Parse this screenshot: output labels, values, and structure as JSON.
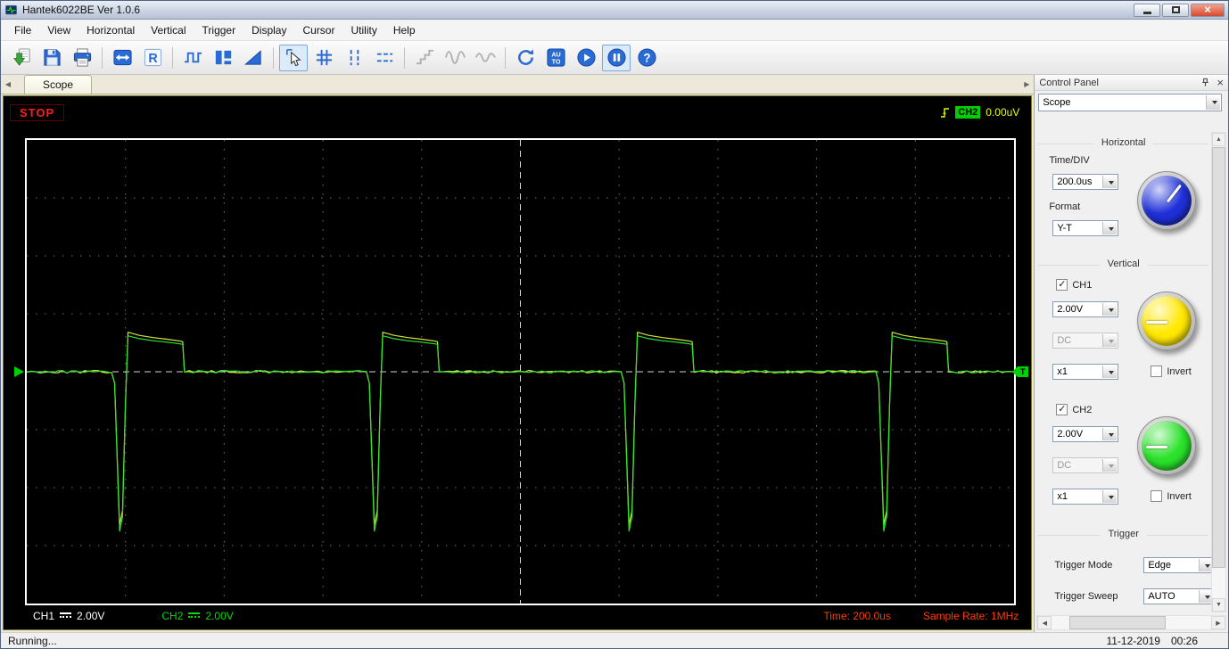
{
  "window": {
    "title": "Hantek6022BE Ver 1.0.6"
  },
  "menu": {
    "items": [
      "File",
      "View",
      "Horizontal",
      "Vertical",
      "Trigger",
      "Display",
      "Cursor",
      "Utility",
      "Help"
    ]
  },
  "toolbar": {
    "buttons": [
      {
        "name": "open-waveform",
        "icon": "open"
      },
      {
        "name": "save-waveform",
        "icon": "save"
      },
      {
        "name": "print",
        "icon": "print"
      },
      {
        "sep": true
      },
      {
        "name": "fit-horizontal",
        "icon": "fit"
      },
      {
        "name": "reference-r",
        "icon": "r"
      },
      {
        "sep": true
      },
      {
        "name": "square-wave",
        "icon": "squarewave"
      },
      {
        "name": "level-bars",
        "icon": "levels"
      },
      {
        "name": "ramp-wave",
        "icon": "ramp"
      },
      {
        "sep": true
      },
      {
        "name": "cursor-select",
        "icon": "cursor",
        "pressed": true
      },
      {
        "name": "cross-cursor",
        "icon": "grid"
      },
      {
        "name": "vertical-cursors",
        "icon": "vcursors"
      },
      {
        "name": "horizontal-cursors",
        "icon": "hcursors"
      },
      {
        "sep": true
      },
      {
        "name": "step-wave",
        "icon": "step",
        "disabled": true
      },
      {
        "name": "sine-wave",
        "icon": "sine",
        "disabled": true
      },
      {
        "name": "sine-wave-2",
        "icon": "sine2",
        "disabled": true
      },
      {
        "sep": true
      },
      {
        "name": "refresh",
        "icon": "refresh"
      },
      {
        "name": "auto-set",
        "icon": "auto"
      },
      {
        "name": "start",
        "icon": "play"
      },
      {
        "name": "pause",
        "icon": "pause",
        "pressed": true
      },
      {
        "name": "help",
        "icon": "help"
      }
    ]
  },
  "tab": {
    "label": "Scope"
  },
  "scope": {
    "stop_label": "STOP",
    "trigger_readout": {
      "channel": "CH2",
      "value": "0.00uV"
    },
    "trigger_marker": "T",
    "ch1": {
      "label": "CH1",
      "volts": "2.00V"
    },
    "ch2": {
      "label": "CH2",
      "volts": "2.00V"
    },
    "time_readout": "Time: 200.0us",
    "sample_rate_readout": "Sample Rate: 1MHz"
  },
  "chart_data": {
    "type": "line",
    "x_axis": {
      "divisions": 10,
      "time_per_div": "200.0us"
    },
    "y_axis": {
      "divisions": 8,
      "ch1_volts_per_div": "2.00V",
      "ch2_volts_per_div": "2.00V"
    },
    "sample_rate": "1MHz",
    "trigger": {
      "source": "CH2",
      "level_readout": "0.00uV",
      "mode": "Edge",
      "sweep": "AUTO"
    },
    "waveform": {
      "description": "Periodic flyback pulse: sharp negative spike followed by decaying positive plateau, baseline at center",
      "period_div": 2.58,
      "cycle_starts_div": [
        0.86,
        3.44,
        6.02,
        8.6
      ],
      "baseline_div": 0,
      "spike_min_div": -2.75,
      "plateau_max_div": 0.62,
      "shape_points": [
        [
          0.0,
          0
        ],
        [
          0.03,
          -0.2
        ],
        [
          0.08,
          -2.75
        ],
        [
          0.11,
          -2.5
        ],
        [
          0.14,
          -0.55
        ],
        [
          0.165,
          0.62
        ],
        [
          0.28,
          0.57
        ],
        [
          0.42,
          0.535
        ],
        [
          0.56,
          0.51
        ],
        [
          0.7,
          0.48
        ],
        [
          0.72,
          0.47
        ],
        [
          0.735,
          0.05
        ],
        [
          0.74,
          0
        ]
      ]
    },
    "series": [
      {
        "name": "CH1",
        "color": "#d8e63c",
        "gain_pos": 1.1,
        "gain_neg": 0.96,
        "seed": 7
      },
      {
        "name": "CH2",
        "color": "#2ce62c",
        "gain_pos": 1.0,
        "gain_neg": 1.0,
        "seed": 13
      }
    ]
  },
  "control_panel": {
    "title": "Control Panel",
    "mode_select": "Scope",
    "horizontal": {
      "title": "Horizontal",
      "time_div_label": "Time/DIV",
      "time_div": "200.0us",
      "format_label": "Format",
      "format": "Y-T",
      "knob_color": "#1f30d8"
    },
    "vertical": {
      "title": "Vertical",
      "ch1": {
        "label": "CH1",
        "checked": true,
        "volts": "2.00V",
        "coupling": "DC",
        "probe": "x1",
        "invert_label": "Invert",
        "invert_checked": false,
        "knob_color": "#ffe800"
      },
      "ch2": {
        "label": "CH2",
        "checked": true,
        "volts": "2.00V",
        "coupling": "DC",
        "probe": "x1",
        "invert_label": "Invert",
        "invert_checked": false,
        "knob_color": "#2ae22a"
      }
    },
    "trigger": {
      "title": "Trigger",
      "mode_label": "Trigger Mode",
      "mode": "Edge",
      "sweep_label": "Trigger Sweep",
      "sweep": "AUTO"
    }
  },
  "status": {
    "left": "Running...",
    "date": "11-12-2019",
    "time": "00:26"
  }
}
